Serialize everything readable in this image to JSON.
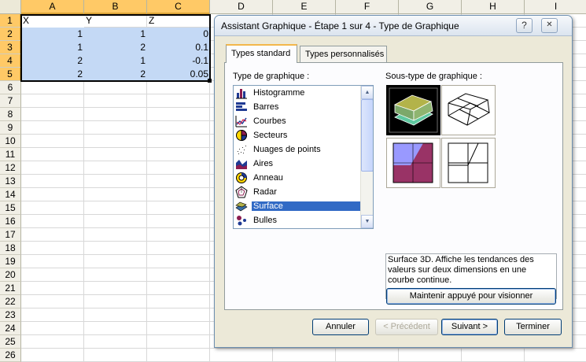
{
  "spreadsheet": {
    "columns": [
      "A",
      "B",
      "C",
      "D",
      "E",
      "F",
      "G",
      "H",
      "I"
    ],
    "rows": [
      "1",
      "2",
      "3",
      "4",
      "5",
      "6",
      "7",
      "8",
      "9",
      "10",
      "11",
      "12",
      "13",
      "14",
      "15",
      "16",
      "17",
      "18",
      "19",
      "20",
      "21",
      "22",
      "23",
      "24",
      "25",
      "26"
    ],
    "header_cells": [
      "X",
      "Y",
      "Z"
    ],
    "data_rows": [
      [
        "1",
        "1",
        "0"
      ],
      [
        "1",
        "2",
        "0.1"
      ],
      [
        "2",
        "1",
        "-0.1"
      ],
      [
        "2",
        "2",
        "0.05"
      ]
    ]
  },
  "dialog": {
    "title": "Assistant Graphique - Étape 1 sur 4 - Type de Graphique",
    "help_glyph": "?",
    "close_glyph": "✕",
    "tabs": [
      {
        "label": "Types standard",
        "active": true
      },
      {
        "label": "Types personnalisés",
        "active": false
      }
    ],
    "chart_type_label": "Type de graphique :",
    "chart_types": [
      {
        "label": "Histogramme",
        "icon": "column-chart-icon",
        "selected": false
      },
      {
        "label": "Barres",
        "icon": "bar-chart-icon",
        "selected": false
      },
      {
        "label": "Courbes",
        "icon": "line-chart-icon",
        "selected": false
      },
      {
        "label": "Secteurs",
        "icon": "pie-chart-icon",
        "selected": false
      },
      {
        "label": "Nuages de points",
        "icon": "scatter-chart-icon",
        "selected": false
      },
      {
        "label": "Aires",
        "icon": "area-chart-icon",
        "selected": false
      },
      {
        "label": "Anneau",
        "icon": "doughnut-chart-icon",
        "selected": false
      },
      {
        "label": "Radar",
        "icon": "radar-chart-icon",
        "selected": false
      },
      {
        "label": "Surface",
        "icon": "surface-chart-icon",
        "selected": true
      },
      {
        "label": "Bulles",
        "icon": "bubble-chart-icon",
        "selected": false
      }
    ],
    "subtype_label": "Sous-type de graphique :",
    "subtypes": [
      {
        "icon": "surface-3d-icon",
        "selected": true
      },
      {
        "icon": "wireframe-3d-icon",
        "selected": false
      },
      {
        "icon": "contour-icon",
        "selected": false
      },
      {
        "icon": "wireframe-contour-icon",
        "selected": false
      }
    ],
    "description": "Surface 3D. Affiche les tendances des valeurs sur deux dimensions en une courbe continue.",
    "preview_button": "Maintenir appuyé pour visionner",
    "buttons": {
      "cancel": "Annuler",
      "previous": "< Précédent",
      "next": "Suivant >",
      "finish": "Terminer"
    },
    "colors": {
      "selection": "#316ac5",
      "range_fill": "#c4d9f5",
      "header_selected": "#ffc966"
    }
  }
}
